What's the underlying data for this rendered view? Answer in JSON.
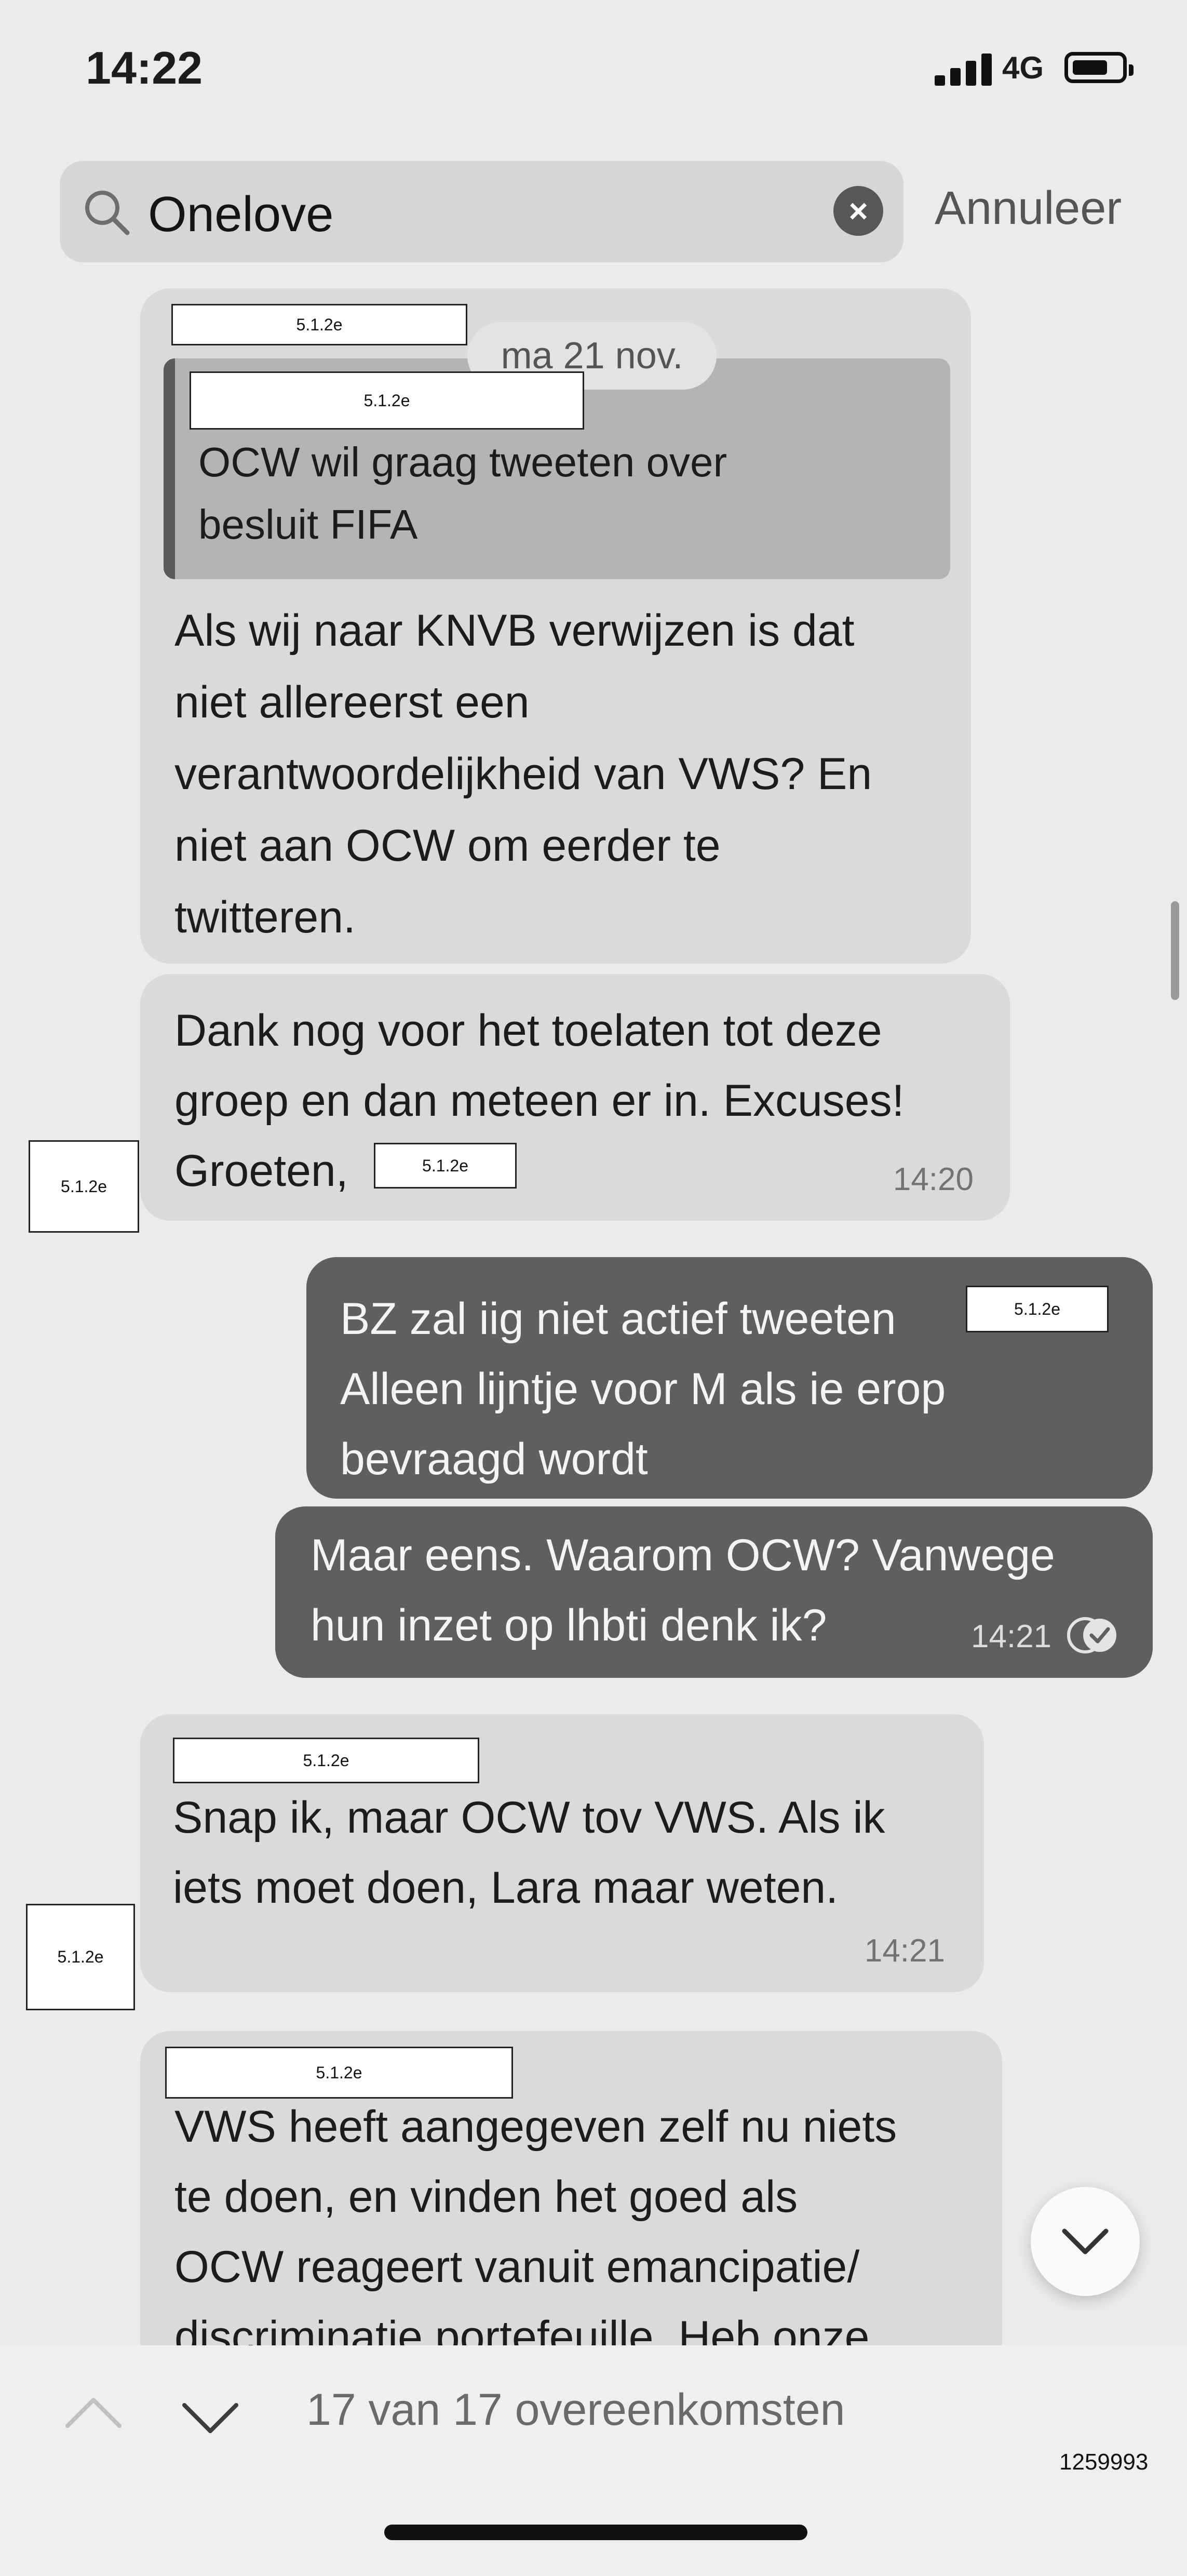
{
  "status_bar": {
    "time": "14:22",
    "network": "4G",
    "battery_level": 0.7
  },
  "search": {
    "query": "Onelove",
    "cancel_label": "Annuleer"
  },
  "redaction_label": "5.1.2e",
  "date_chip": "ma 21 nov.",
  "messages": [
    {
      "direction": "incoming",
      "quote": [
        "OCW wil graag tweeten over",
        "besluit FIFA"
      ],
      "lines": [
        "Als wij naar KNVB verwijzen is dat",
        "niet allereerst een",
        "verantwoordelijkheid van VWS? En",
        "niet aan OCW om eerder te",
        "twitteren."
      ]
    },
    {
      "direction": "incoming",
      "lines": [
        "Dank nog voor het toelaten tot deze",
        "groep en dan meteen er in. Excuses!",
        "Groeten,"
      ],
      "time": "14:20"
    },
    {
      "direction": "outgoing",
      "lines": [
        "BZ zal iig niet actief tweeten",
        "Alleen lijntje voor M als ie erop",
        "bevraagd wordt"
      ]
    },
    {
      "direction": "outgoing",
      "lines": [
        "Maar eens. Waarom OCW? Vanwege",
        "hun inzet op lhbti denk ik?"
      ],
      "time": "14:21"
    },
    {
      "direction": "incoming",
      "lines": [
        "Snap ik, maar OCW tov VWS. Als ik",
        "iets moet doen, Lara maar weten."
      ],
      "time": "14:21"
    },
    {
      "direction": "incoming",
      "lines": [
        "VWS heeft aangegeven zelf nu niets",
        "te doen, en vinden het goed als",
        "OCW reageert vanuit emancipatie/",
        "discriminatie portefeuille. Heb onze"
      ]
    }
  ],
  "footer": {
    "match_count": "17 van 17 overeenkomsten"
  },
  "doc_number": "1259993",
  "colors": {
    "background": "#ebebeb",
    "incoming_bubble": "#dadada",
    "outgoing_bubble": "#5f5f5f",
    "quote_box": "#b4b4b4"
  },
  "icons": [
    "signal-icon",
    "battery-icon",
    "search-icon",
    "clear-icon",
    "read-receipt-icon",
    "chevron-down-icon",
    "chevron-up-icon"
  ]
}
